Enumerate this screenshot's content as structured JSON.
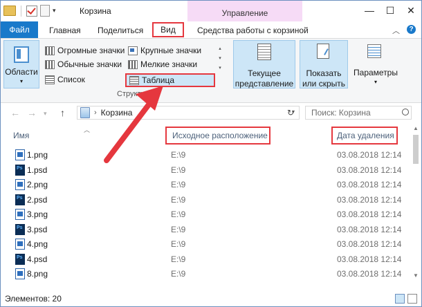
{
  "window": {
    "title": "Корзина",
    "manage_tab": "Управление"
  },
  "window_buttons": {
    "minimize": "—",
    "maximize": "☐",
    "close": "✕"
  },
  "tabs": {
    "file": "Файл",
    "home": "Главная",
    "share": "Поделиться",
    "view": "Вид",
    "tools": "Средства работы с корзиной"
  },
  "ribbon": {
    "panes": "Области",
    "layout": {
      "huge": "Огромные значки",
      "large": "Крупные значки",
      "normal": "Обычные значки",
      "small": "Мелкие значки",
      "list": "Список",
      "table": "Таблица"
    },
    "layout_group_label": "Структура",
    "current_view": "Текущее представление",
    "show_hide": "Показать или скрыть",
    "options": "Параметры"
  },
  "address": {
    "location": "Корзина",
    "search_placeholder": "Поиск: Корзина"
  },
  "columns": {
    "name": "Имя",
    "original_location": "Исходное расположение",
    "date_deleted": "Дата удаления"
  },
  "files": [
    {
      "name": "1.png",
      "type": "png",
      "location": "E:\\9",
      "date": "03.08.2018 12:14"
    },
    {
      "name": "1.psd",
      "type": "psd",
      "location": "E:\\9",
      "date": "03.08.2018 12:14"
    },
    {
      "name": "2.png",
      "type": "png",
      "location": "E:\\9",
      "date": "03.08.2018 12:14"
    },
    {
      "name": "2.psd",
      "type": "psd",
      "location": "E:\\9",
      "date": "03.08.2018 12:14"
    },
    {
      "name": "3.png",
      "type": "png",
      "location": "E:\\9",
      "date": "03.08.2018 12:14"
    },
    {
      "name": "3.psd",
      "type": "psd",
      "location": "E:\\9",
      "date": "03.08.2018 12:14"
    },
    {
      "name": "4.png",
      "type": "png",
      "location": "E:\\9",
      "date": "03.08.2018 12:14"
    },
    {
      "name": "4.psd",
      "type": "psd",
      "location": "E:\\9",
      "date": "03.08.2018 12:14"
    },
    {
      "name": "8.png",
      "type": "png",
      "location": "E:\\9",
      "date": "03.08.2018 12:14"
    }
  ],
  "status": {
    "count": "Элементов: 20"
  },
  "colors": {
    "accent": "#1979ca",
    "highlight": "#e5373e",
    "selection": "#cde6f7",
    "manage_tab": "#f6dbf6"
  }
}
